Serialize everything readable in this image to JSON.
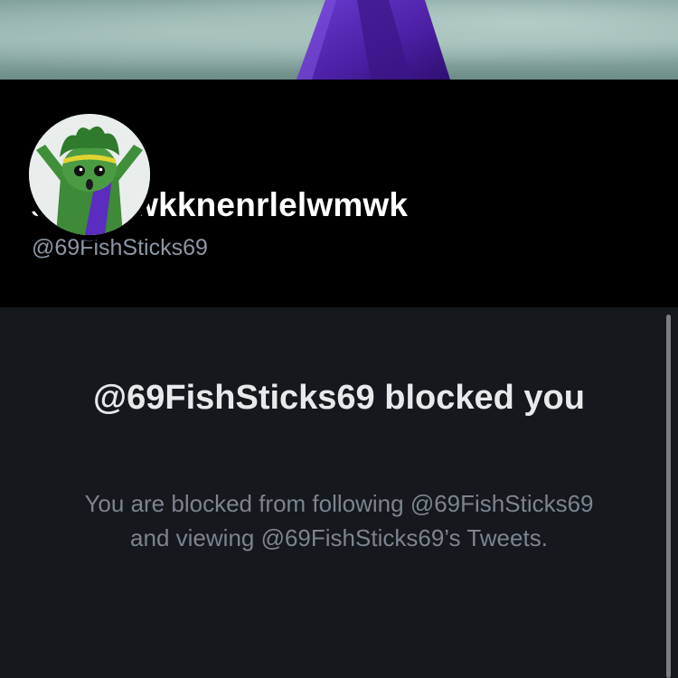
{
  "profile": {
    "display_name": "ssswkwkknenrlelwmwk",
    "handle": "@69FishSticks69",
    "avatar_icon": "cartoon-character-avatar",
    "banner_icon": "banner-image"
  },
  "blocked_notice": {
    "title": "@69FishSticks69 blocked you",
    "description": "You are blocked from following @69FishSticks69 and viewing @69FishSticks69’s Tweets."
  },
  "colors": {
    "header_background": "#000000",
    "content_background": "#15181c",
    "primary_text": "#e7e9ea",
    "secondary_text": "#8b98a5",
    "banner_purple": "#4b1fa3"
  }
}
